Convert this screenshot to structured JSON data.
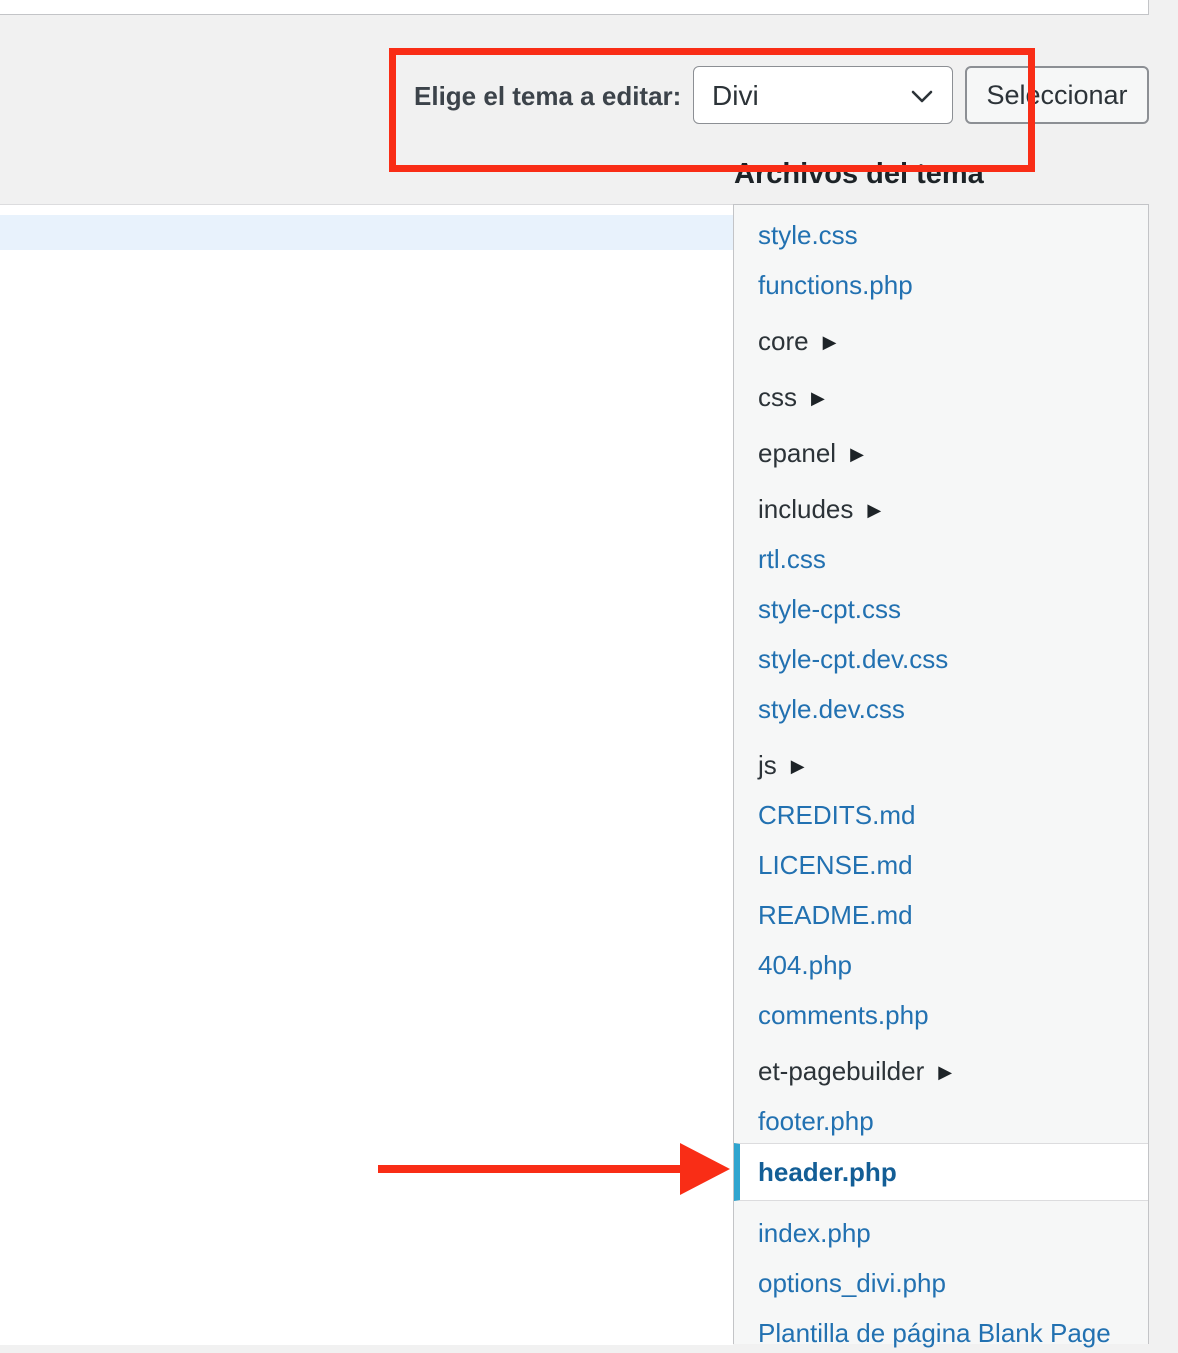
{
  "theme_selector": {
    "label": "Elige el tema a editar:",
    "selected_theme": "Divi",
    "select_button": "Seleccionar"
  },
  "files_panel": {
    "heading": "Archivos del tema",
    "items": [
      {
        "label": "style.css",
        "type": "file"
      },
      {
        "label": "functions.php",
        "type": "file"
      },
      {
        "label": "core",
        "type": "folder"
      },
      {
        "label": "css",
        "type": "folder"
      },
      {
        "label": "epanel",
        "type": "folder"
      },
      {
        "label": "includes",
        "type": "folder"
      },
      {
        "label": "rtl.css",
        "type": "file"
      },
      {
        "label": "style-cpt.css",
        "type": "file"
      },
      {
        "label": "style-cpt.dev.css",
        "type": "file"
      },
      {
        "label": "style.dev.css",
        "type": "file"
      },
      {
        "label": "js",
        "type": "folder"
      },
      {
        "label": "CREDITS.md",
        "type": "file"
      },
      {
        "label": "LICENSE.md",
        "type": "file"
      },
      {
        "label": "README.md",
        "type": "file"
      },
      {
        "label": "404.php",
        "type": "file"
      },
      {
        "label": "comments.php",
        "type": "file"
      },
      {
        "label": "et-pagebuilder",
        "type": "folder"
      },
      {
        "label": "footer.php",
        "type": "file"
      },
      {
        "label": "header.php",
        "type": "file",
        "selected": true
      },
      {
        "label": "index.php",
        "type": "file"
      },
      {
        "label": "options_divi.php",
        "type": "file"
      },
      {
        "label": "Plantilla de página Blank Page",
        "type": "file"
      }
    ]
  },
  "colors": {
    "link": "#2271b1",
    "selected_link": "#135e96",
    "selected_marker": "#2fa5cf",
    "annotation": "#f92d16",
    "active_line": "#e8f2fc"
  },
  "icons": {
    "select_chevron": "chevron-down-icon",
    "folder_toggle": "caret-right-icon",
    "annotation_arrow": "arrow-right-icon"
  }
}
